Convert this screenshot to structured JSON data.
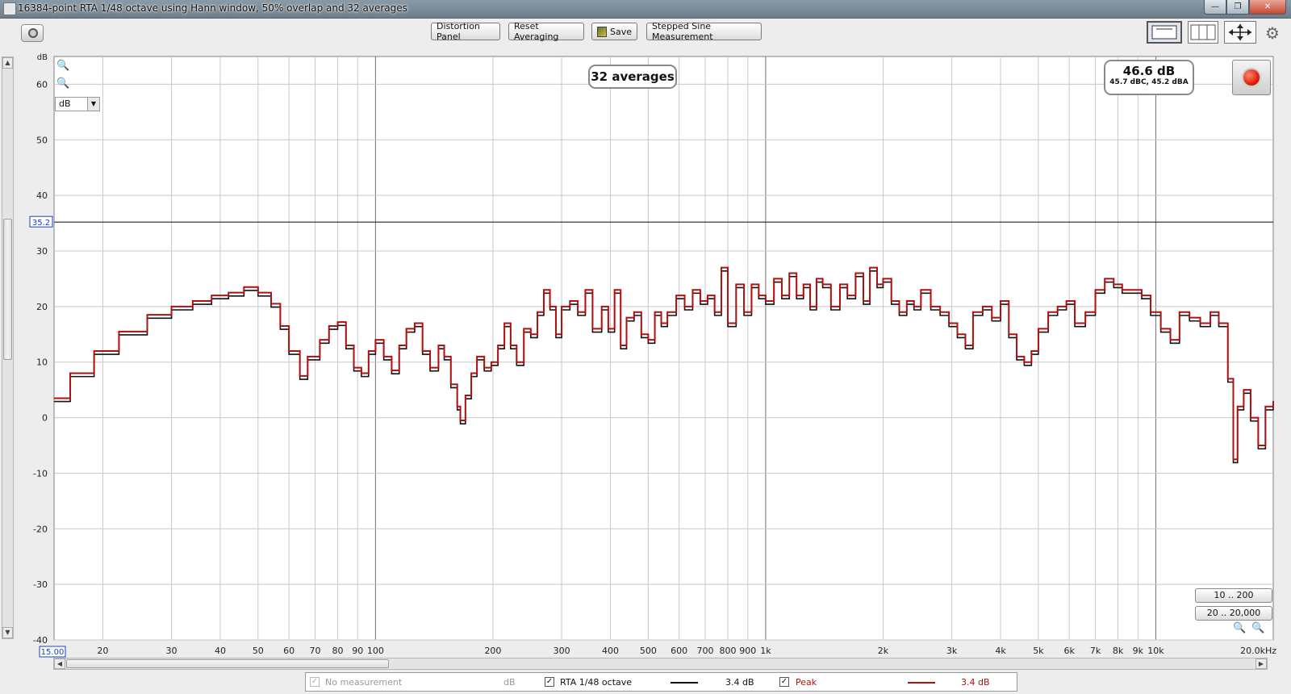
{
  "window": {
    "title": "16384-point RTA 1/48 octave using Hann window, 50% overlap and 32 averages",
    "minimize_glyph": "—",
    "restore_glyph": "❐",
    "close_glyph": "✕"
  },
  "toolbar": {
    "distortion_label": "Distortion Panel",
    "reset_label": "Reset Averaging",
    "save_label": "Save",
    "stepped_label": "Stepped Sine Measurement"
  },
  "icons": {
    "camera": "camera-icon",
    "save": "save-icon",
    "layout": "single-layout-icon",
    "columns": "columns-icon",
    "fit": "fit-arrows-icon",
    "gear": "gear-icon",
    "record": "record-icon"
  },
  "overlay": {
    "averages_text": "32 averages",
    "level_main": "46.6 dB",
    "level_sub": "45.7 dBC, 45.2 dBA"
  },
  "controls": {
    "unit_select_value": "dB",
    "range_btn_1": "10 .. 200",
    "range_btn_2": "20 .. 20,000",
    "xaxis_start_value": "15.00"
  },
  "legend": {
    "item0_label": "No measurement",
    "item0_unit": "dB",
    "item1_label": "RTA 1/48 octave",
    "item1_value": "3.4 dB",
    "item2_label": "Peak",
    "item2_value": "3.4 dB"
  },
  "colors": {
    "rta_line": "#111111",
    "peak_line": "#b01010",
    "grid": "#c8c8c8",
    "major_grid": "#707070",
    "cursor_label": "#1a3fbf"
  },
  "chart_data": {
    "type": "line",
    "title": "",
    "xlabel": "",
    "ylabel": "dB",
    "x_scale": "log",
    "xlim": [
      15,
      20000
    ],
    "ylim": [
      -40,
      65
    ],
    "grid": true,
    "legend_position": "bottom",
    "y_ticks": [
      "60",
      "50",
      "40",
      "30",
      "20",
      "10",
      "0",
      "-10",
      "-20",
      "-30",
      "-40"
    ],
    "x_ticks": [
      {
        "v": 20,
        "t": "20"
      },
      {
        "v": 30,
        "t": "30"
      },
      {
        "v": 40,
        "t": "40"
      },
      {
        "v": 50,
        "t": "50"
      },
      {
        "v": 60,
        "t": "60"
      },
      {
        "v": 70,
        "t": "70"
      },
      {
        "v": 80,
        "t": "80"
      },
      {
        "v": 90,
        "t": "90"
      },
      {
        "v": 100,
        "t": "100"
      },
      {
        "v": 200,
        "t": "200"
      },
      {
        "v": 300,
        "t": "300"
      },
      {
        "v": 400,
        "t": "400"
      },
      {
        "v": 500,
        "t": "500"
      },
      {
        "v": 600,
        "t": "600"
      },
      {
        "v": 700,
        "t": "700"
      },
      {
        "v": 800,
        "t": "800"
      },
      {
        "v": 900,
        "t": "900"
      },
      {
        "v": 1000,
        "t": "1k"
      },
      {
        "v": 2000,
        "t": "2k"
      },
      {
        "v": 3000,
        "t": "3k"
      },
      {
        "v": 4000,
        "t": "4k"
      },
      {
        "v": 5000,
        "t": "5k"
      },
      {
        "v": 6000,
        "t": "6k"
      },
      {
        "v": 7000,
        "t": "7k"
      },
      {
        "v": 8000,
        "t": "8k"
      },
      {
        "v": 9000,
        "t": "9k"
      },
      {
        "v": 10000,
        "t": "10k"
      },
      {
        "v": 20000,
        "t": "20.0kHz"
      }
    ],
    "cursor_level": 35.2,
    "cursor_label": "35.2",
    "series": [
      {
        "name": "RTA 1/48 octave",
        "color": "#111111",
        "offset": -0.6,
        "points": [
          [
            15,
            3.5
          ],
          [
            16.5,
            8
          ],
          [
            19,
            12
          ],
          [
            22,
            15.5
          ],
          [
            26,
            18.5
          ],
          [
            30,
            20
          ],
          [
            34,
            21
          ],
          [
            38,
            22
          ],
          [
            42,
            22.5
          ],
          [
            46,
            23.5
          ],
          [
            50,
            22.5
          ],
          [
            54,
            20.5
          ],
          [
            57,
            16.5
          ],
          [
            60,
            12
          ],
          [
            64,
            7.5
          ],
          [
            67,
            11
          ],
          [
            72,
            14
          ],
          [
            76,
            16.5
          ],
          [
            80,
            17.2
          ],
          [
            84,
            13
          ],
          [
            88,
            9
          ],
          [
            92,
            8
          ],
          [
            96,
            12
          ],
          [
            100,
            14
          ],
          [
            105,
            11
          ],
          [
            110,
            8.5
          ],
          [
            115,
            13
          ],
          [
            120,
            16
          ],
          [
            126,
            17
          ],
          [
            132,
            12
          ],
          [
            138,
            9
          ],
          [
            145,
            13
          ],
          [
            150,
            11
          ],
          [
            156,
            6
          ],
          [
            162,
            2
          ],
          [
            165,
            -0.5
          ],
          [
            170,
            4
          ],
          [
            176,
            8
          ],
          [
            182,
            11
          ],
          [
            190,
            9
          ],
          [
            198,
            10
          ],
          [
            206,
            13
          ],
          [
            214,
            17
          ],
          [
            222,
            13
          ],
          [
            230,
            10
          ],
          [
            240,
            16
          ],
          [
            250,
            15
          ],
          [
            260,
            19
          ],
          [
            270,
            23
          ],
          [
            280,
            20
          ],
          [
            290,
            15
          ],
          [
            300,
            20
          ],
          [
            315,
            21
          ],
          [
            330,
            19
          ],
          [
            345,
            23
          ],
          [
            360,
            16
          ],
          [
            380,
            20
          ],
          [
            395,
            16
          ],
          [
            410,
            23
          ],
          [
            425,
            13
          ],
          [
            440,
            18
          ],
          [
            460,
            19
          ],
          [
            480,
            15
          ],
          [
            500,
            14
          ],
          [
            520,
            19
          ],
          [
            540,
            17
          ],
          [
            560,
            19
          ],
          [
            590,
            22
          ],
          [
            620,
            20
          ],
          [
            650,
            23
          ],
          [
            680,
            21
          ],
          [
            710,
            22
          ],
          [
            740,
            19
          ],
          [
            770,
            27
          ],
          [
            800,
            17
          ],
          [
            840,
            24
          ],
          [
            880,
            19
          ],
          [
            920,
            24
          ],
          [
            960,
            22
          ],
          [
            1000,
            21
          ],
          [
            1050,
            25
          ],
          [
            1100,
            22
          ],
          [
            1150,
            26
          ],
          [
            1200,
            22
          ],
          [
            1250,
            24
          ],
          [
            1300,
            20
          ],
          [
            1350,
            25
          ],
          [
            1400,
            24
          ],
          [
            1470,
            20
          ],
          [
            1550,
            24
          ],
          [
            1620,
            22
          ],
          [
            1700,
            26
          ],
          [
            1780,
            21
          ],
          [
            1850,
            27
          ],
          [
            1930,
            24
          ],
          [
            2000,
            25
          ],
          [
            2100,
            21
          ],
          [
            2200,
            19
          ],
          [
            2300,
            21
          ],
          [
            2400,
            20
          ],
          [
            2500,
            23
          ],
          [
            2650,
            20
          ],
          [
            2800,
            19
          ],
          [
            2950,
            17
          ],
          [
            3100,
            15
          ],
          [
            3250,
            13
          ],
          [
            3400,
            19
          ],
          [
            3600,
            20
          ],
          [
            3800,
            18
          ],
          [
            4000,
            21
          ],
          [
            4200,
            15
          ],
          [
            4400,
            11
          ],
          [
            4600,
            10
          ],
          [
            4800,
            12
          ],
          [
            5000,
            16
          ],
          [
            5300,
            19
          ],
          [
            5600,
            20
          ],
          [
            5900,
            21
          ],
          [
            6200,
            17
          ],
          [
            6600,
            19
          ],
          [
            7000,
            23
          ],
          [
            7400,
            25
          ],
          [
            7800,
            24
          ],
          [
            8200,
            23
          ],
          [
            8700,
            23
          ],
          [
            9200,
            22
          ],
          [
            9700,
            19
          ],
          [
            10300,
            16
          ],
          [
            10900,
            14
          ],
          [
            11500,
            19
          ],
          [
            12200,
            18
          ],
          [
            13000,
            17
          ],
          [
            13800,
            19
          ],
          [
            14500,
            17
          ],
          [
            15300,
            7
          ],
          [
            15800,
            -7.5
          ],
          [
            16200,
            2
          ],
          [
            16800,
            5
          ],
          [
            17500,
            0
          ],
          [
            18300,
            -5
          ],
          [
            19100,
            2
          ],
          [
            20000,
            3
          ]
        ]
      },
      {
        "name": "Peak",
        "color": "#b01010",
        "offset": 0,
        "points": [
          [
            15,
            3.5
          ],
          [
            16.5,
            8
          ],
          [
            19,
            12
          ],
          [
            22,
            15.5
          ],
          [
            26,
            18.5
          ],
          [
            30,
            20
          ],
          [
            34,
            21
          ],
          [
            38,
            22
          ],
          [
            42,
            22.5
          ],
          [
            46,
            23.5
          ],
          [
            50,
            22.5
          ],
          [
            54,
            20.5
          ],
          [
            57,
            16.5
          ],
          [
            60,
            12
          ],
          [
            64,
            7.5
          ],
          [
            67,
            11
          ],
          [
            72,
            14
          ],
          [
            76,
            16.5
          ],
          [
            80,
            17.2
          ],
          [
            84,
            13
          ],
          [
            88,
            9
          ],
          [
            92,
            8
          ],
          [
            96,
            12
          ],
          [
            100,
            14
          ],
          [
            105,
            11
          ],
          [
            110,
            8.5
          ],
          [
            115,
            13
          ],
          [
            120,
            16
          ],
          [
            126,
            17
          ],
          [
            132,
            12
          ],
          [
            138,
            9
          ],
          [
            145,
            13
          ],
          [
            150,
            11
          ],
          [
            156,
            6
          ],
          [
            162,
            2
          ],
          [
            165,
            -0.5
          ],
          [
            170,
            4
          ],
          [
            176,
            8
          ],
          [
            182,
            11
          ],
          [
            190,
            9
          ],
          [
            198,
            10
          ],
          [
            206,
            13
          ],
          [
            214,
            17
          ],
          [
            222,
            13
          ],
          [
            230,
            10
          ],
          [
            240,
            16
          ],
          [
            250,
            15
          ],
          [
            260,
            19
          ],
          [
            270,
            23
          ],
          [
            280,
            20
          ],
          [
            290,
            15
          ],
          [
            300,
            20
          ],
          [
            315,
            21
          ],
          [
            330,
            19
          ],
          [
            345,
            23
          ],
          [
            360,
            16
          ],
          [
            380,
            20
          ],
          [
            395,
            16
          ],
          [
            410,
            23
          ],
          [
            425,
            13
          ],
          [
            440,
            18
          ],
          [
            460,
            19
          ],
          [
            480,
            15
          ],
          [
            500,
            14
          ],
          [
            520,
            19
          ],
          [
            540,
            17
          ],
          [
            560,
            19
          ],
          [
            590,
            22
          ],
          [
            620,
            20
          ],
          [
            650,
            23
          ],
          [
            680,
            21
          ],
          [
            710,
            22
          ],
          [
            740,
            19
          ],
          [
            770,
            27
          ],
          [
            800,
            17
          ],
          [
            840,
            24
          ],
          [
            880,
            19
          ],
          [
            920,
            24
          ],
          [
            960,
            22
          ],
          [
            1000,
            21
          ],
          [
            1050,
            25
          ],
          [
            1100,
            22
          ],
          [
            1150,
            26
          ],
          [
            1200,
            22
          ],
          [
            1250,
            24
          ],
          [
            1300,
            20
          ],
          [
            1350,
            25
          ],
          [
            1400,
            24
          ],
          [
            1470,
            20
          ],
          [
            1550,
            24
          ],
          [
            1620,
            22
          ],
          [
            1700,
            26
          ],
          [
            1780,
            21
          ],
          [
            1850,
            27
          ],
          [
            1930,
            24
          ],
          [
            2000,
            25
          ],
          [
            2100,
            21
          ],
          [
            2200,
            19
          ],
          [
            2300,
            21
          ],
          [
            2400,
            20
          ],
          [
            2500,
            23
          ],
          [
            2650,
            20
          ],
          [
            2800,
            19
          ],
          [
            2950,
            17
          ],
          [
            3100,
            15
          ],
          [
            3250,
            13
          ],
          [
            3400,
            19
          ],
          [
            3600,
            20
          ],
          [
            3800,
            18
          ],
          [
            4000,
            21
          ],
          [
            4200,
            15
          ],
          [
            4400,
            11
          ],
          [
            4600,
            10
          ],
          [
            4800,
            12
          ],
          [
            5000,
            16
          ],
          [
            5300,
            19
          ],
          [
            5600,
            20
          ],
          [
            5900,
            21
          ],
          [
            6200,
            17
          ],
          [
            6600,
            19
          ],
          [
            7000,
            23
          ],
          [
            7400,
            25
          ],
          [
            7800,
            24
          ],
          [
            8200,
            23
          ],
          [
            8700,
            23
          ],
          [
            9200,
            22
          ],
          [
            9700,
            19
          ],
          [
            10300,
            16
          ],
          [
            10900,
            14
          ],
          [
            11500,
            19
          ],
          [
            12200,
            18
          ],
          [
            13000,
            17
          ],
          [
            13800,
            19
          ],
          [
            14500,
            17
          ],
          [
            15300,
            7
          ],
          [
            15800,
            -7.5
          ],
          [
            16200,
            2
          ],
          [
            16800,
            5
          ],
          [
            17500,
            0
          ],
          [
            18300,
            -5
          ],
          [
            19100,
            2
          ],
          [
            20000,
            3
          ]
        ]
      }
    ]
  }
}
